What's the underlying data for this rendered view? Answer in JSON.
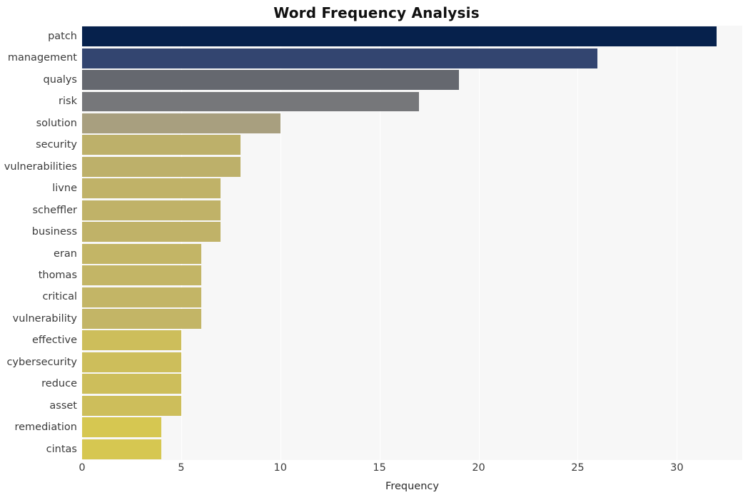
{
  "chart_data": {
    "type": "bar",
    "orientation": "horizontal",
    "title": "Word Frequency Analysis",
    "xlabel": "Frequency",
    "ylabel": "",
    "xlim": [
      0,
      33.3
    ],
    "ylim": [
      0,
      20
    ],
    "grid": true,
    "gridlines_vertical": [
      0,
      5,
      10,
      15,
      20,
      25,
      30
    ],
    "legend": null,
    "legend_position": "none",
    "xticks": [
      0,
      5,
      10,
      15,
      20,
      25,
      30
    ],
    "xtick_labels": [
      "0",
      "5",
      "10",
      "15",
      "20",
      "25",
      "30"
    ],
    "categories": [
      "patch",
      "management",
      "qualys",
      "risk",
      "solution",
      "security",
      "vulnerabilities",
      "livne",
      "scheffler",
      "business",
      "eran",
      "thomas",
      "critical",
      "vulnerability",
      "effective",
      "cybersecurity",
      "reduce",
      "asset",
      "remediation",
      "cintas"
    ],
    "values": [
      32,
      26,
      19,
      17,
      10,
      8,
      8,
      7,
      7,
      7,
      6,
      6,
      6,
      6,
      5,
      5,
      5,
      5,
      4,
      4
    ],
    "bar_colors": [
      "#06214c",
      "#334570",
      "#65686f",
      "#76777a",
      "#a89f7f",
      "#bdb06a",
      "#bdb06a",
      "#c0b268",
      "#c0b268",
      "#c0b268",
      "#c3b566",
      "#c3b566",
      "#c3b566",
      "#c3b566",
      "#cdbe5b",
      "#cdbe5b",
      "#cdbe5b",
      "#cdbe5b",
      "#d6c751",
      "#d6c751"
    ]
  },
  "style": {
    "figure_background": "#ffffff",
    "plot_background": "#f7f7f7",
    "gridline_color": "#ffffff",
    "title_color": "#111111",
    "tick_label_color": "#3b3b3b"
  }
}
